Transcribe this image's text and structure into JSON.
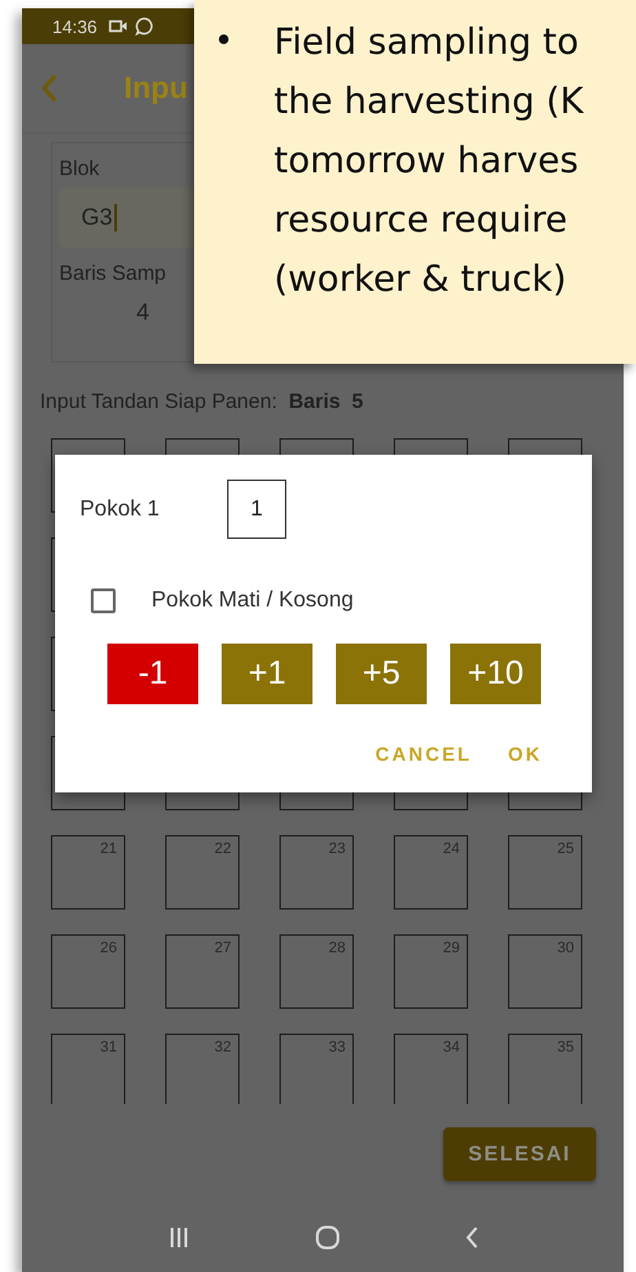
{
  "status_bar": {
    "time": "14:36"
  },
  "app_bar": {
    "title": "Inpu"
  },
  "form": {
    "fields": [
      {
        "label": "Blok",
        "value": "G3",
        "kind": "text-input",
        "focused": true
      },
      {
        "label": "Baris Samp",
        "value": "4",
        "kind": "display",
        "focused": false
      }
    ]
  },
  "grid_heading": "Input Tandan Siap Panen:  **Baris  5**",
  "grid": {
    "cells": [
      {
        "kind": "blank"
      },
      {
        "kind": "blank"
      },
      {
        "kind": "blank"
      },
      {
        "kind": "blank"
      },
      {
        "kind": "blank"
      },
      {
        "kind": "blank"
      },
      {
        "kind": "blank"
      },
      {
        "kind": "blank"
      },
      {
        "kind": "blank"
      },
      {
        "kind": "blank"
      },
      {
        "kind": "blank"
      },
      {
        "kind": "blank"
      },
      {
        "kind": "blank"
      },
      {
        "kind": "blank"
      },
      {
        "kind": "blank"
      },
      {
        "kind": "blank"
      },
      {
        "kind": "blank"
      },
      {
        "kind": "blank"
      },
      {
        "kind": "blank"
      },
      {
        "kind": "blank"
      },
      {
        "kind": "numbered",
        "number": "21"
      },
      {
        "kind": "numbered",
        "number": "22"
      },
      {
        "kind": "numbered",
        "number": "23"
      },
      {
        "kind": "numbered",
        "number": "24"
      },
      {
        "kind": "numbered",
        "number": "25"
      },
      {
        "kind": "numbered",
        "number": "26"
      },
      {
        "kind": "numbered",
        "number": "27"
      },
      {
        "kind": "numbered",
        "number": "28"
      },
      {
        "kind": "numbered",
        "number": "29"
      },
      {
        "kind": "numbered",
        "number": "30"
      },
      {
        "kind": "numbered",
        "number": "31"
      },
      {
        "kind": "numbered",
        "number": "32"
      },
      {
        "kind": "numbered",
        "number": "33"
      },
      {
        "kind": "numbered",
        "number": "34"
      },
      {
        "kind": "numbered",
        "number": "35"
      }
    ]
  },
  "footer": {
    "button": "SELESAI"
  },
  "dialog": {
    "title": "Pokok 1",
    "count": "1",
    "checkbox": {
      "label": "Pokok Mati / Kosong",
      "checked": false
    },
    "steps": [
      {
        "label": "-1",
        "kind": "decrement"
      },
      {
        "label": "+1",
        "kind": "increment"
      },
      {
        "label": "+5",
        "kind": "increment"
      },
      {
        "label": "+10",
        "kind": "increment"
      }
    ],
    "actions": [
      "CANCEL",
      "OK"
    ]
  },
  "callout": {
    "lines": [
      "Field sampling to",
      "the harvesting (K",
      "tomorrow harves",
      "resource require",
      "(worker & truck)"
    ]
  }
}
